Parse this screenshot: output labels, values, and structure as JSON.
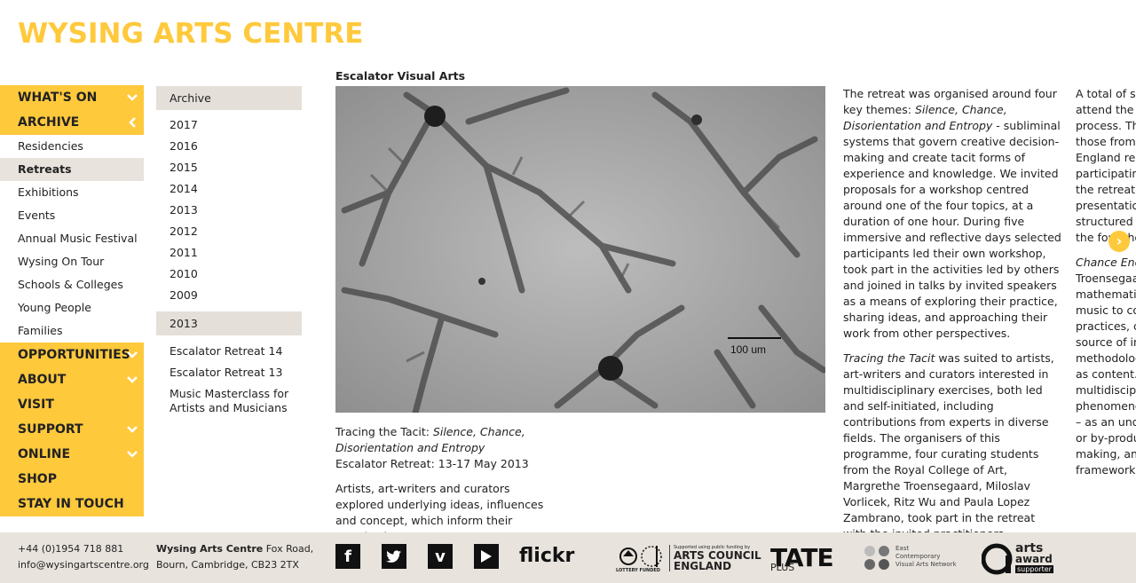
{
  "site": {
    "logo": "WYSING ARTS CENTRE"
  },
  "nav": {
    "items": [
      {
        "label": "WHAT'S ON",
        "chevron": "down"
      },
      {
        "label": "ARCHIVE",
        "chevron": "left"
      }
    ],
    "archive_sub": [
      "Residencies",
      "Retreats",
      "Exhibitions",
      "Events",
      "Annual Music Festival",
      "Wysing On Tour",
      "Schools & Colleges",
      "Young People",
      "Families"
    ],
    "items_after": [
      {
        "label": "OPPORTUNITIES",
        "chevron": "down"
      },
      {
        "label": "ABOUT",
        "chevron": "down"
      },
      {
        "label": "VISIT",
        "chevron": ""
      },
      {
        "label": "SUPPORT",
        "chevron": "down"
      },
      {
        "label": "ONLINE",
        "chevron": "down"
      },
      {
        "label": "SHOP",
        "chevron": ""
      },
      {
        "label": "STAY IN TOUCH",
        "chevron": ""
      }
    ]
  },
  "archive": {
    "heading": "Archive",
    "years": [
      "2017",
      "2016",
      "2015",
      "2014",
      "2013",
      "2012",
      "2011",
      "2010",
      "2009"
    ],
    "year_heading": "2013",
    "year_items": [
      "Escalator Retreat 14",
      "Escalator Retreat 13",
      "Music Masterclass for Artists and Musicians"
    ]
  },
  "article": {
    "title": "Escalator Visual Arts",
    "scale_label": "100 um",
    "caption_prefix": "Tracing the Tacit: ",
    "caption_italic": "Silence, Chance, Disorientation and Entropy",
    "caption_line2": "Escalator Retreat: 13-17 May 2013",
    "intro": "Artists, art-writers and curators explored underlying ideas, influences and concept, which inform their practice but are not",
    "p1_a": "The retreat was organised around four key themes: ",
    "p1_i": "Silence, Chance, Disorientation and Entropy",
    "p1_b": " - subliminal systems that govern creative decision-making and create tacit forms of experience and knowledge. We invited proposals for a workshop centred around one of the four topics, at a duration of one hour. During five immersive and reflective days selected participants led their own workshop, took part in the activities led by others and joined in talks by invited speakers as a means of exploring their practice, sharing ideas, and approaching their work from other perspectives.",
    "p2_i": "Tracing the Tacit",
    "p2_b": " was suited to artists, art-writers and curators interested in multidisciplinary exercises, both led and self-initiated, including contributions from experts in diverse fields. The organisers of this programme, four curating students from the Royal College of Art, Margrethe Troensegaard, Miloslav Vorlicek, Ritz Wu and Paula Lopez Zambrano, took part in the retreat with the invited practitioners.",
    "col3_lines": [
      "A total of six",
      "attend the re",
      "process. Thr",
      "those from t",
      "England reg",
      "participating",
      "the retreat w",
      "presentation",
      "structured as",
      "the four ther"
    ],
    "col3_italic": "Chance Enco",
    "col3_lines2": [
      "Troensegaar",
      "mathematics",
      "music to cor",
      "practices, ch",
      "source of ins",
      "methodolog",
      "as content. T",
      "multidiscipli",
      "phenomenor",
      "– as an unde",
      "or by-produc",
      "making, and",
      "framework."
    ]
  },
  "footer": {
    "phone": "+44 (0)1954 718 881",
    "email": "info@wysingartscentre.org",
    "addr_bold": "Wysing Arts Centre",
    "addr_rest": " Fox Road,",
    "addr_line2": "Bourn, Cambridge, CB23 2TX",
    "flickr": "flickr",
    "ac_small": "Supported using public funding by",
    "ac_line1": "ARTS COUNCIL",
    "ac_line2": "ENGLAND",
    "lottery": "LOTTERY FUNDED",
    "tate": "TATE",
    "tate_plus": "PLUS",
    "ecvan_1": "East",
    "ecvan_2": "Contemporary",
    "ecvan_3": "Visual Arts Network",
    "arts_award_1": "arts",
    "arts_award_2": "award",
    "arts_award_3": "supporter"
  }
}
